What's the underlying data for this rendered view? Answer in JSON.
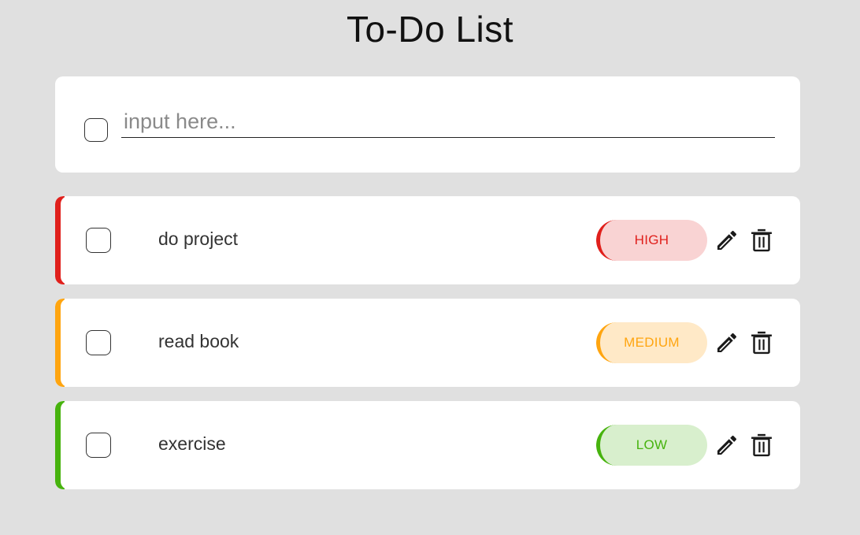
{
  "page": {
    "title": "To-Do List"
  },
  "new_task": {
    "placeholder": "input here...",
    "value": ""
  },
  "tasks": [
    {
      "label": "do project",
      "priority": "HIGH",
      "checked": false,
      "accent": "#e0201c",
      "badge_bg": "#f9d3d3"
    },
    {
      "label": "read book",
      "priority": "MEDIUM",
      "checked": false,
      "accent": "#ffa510",
      "badge_bg": "#ffe9c7"
    },
    {
      "label": "exercise",
      "priority": "LOW",
      "checked": false,
      "accent": "#47b30e",
      "badge_bg": "#d8efcd"
    }
  ],
  "icons": {
    "edit": "pencil-icon",
    "delete": "trash-icon"
  }
}
